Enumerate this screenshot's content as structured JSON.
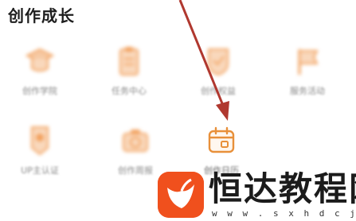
{
  "section": {
    "title": "创作成长"
  },
  "grid": {
    "items": [
      {
        "label": "创作学院",
        "icon": "graduation-cap-icon"
      },
      {
        "label": "任务中心",
        "icon": "clipboard-icon"
      },
      {
        "label": "创作权益",
        "icon": "shield-icon"
      },
      {
        "label": "服务活动",
        "icon": "flag-icon"
      },
      {
        "label": "UP主认证",
        "icon": "badge-icon"
      },
      {
        "label": "创作周报",
        "icon": "camera-icon"
      },
      {
        "label": "创作日历",
        "icon": "calendar-icon"
      }
    ]
  },
  "watermark": {
    "brand": "恒达教程网",
    "url": "w w w . s x h d c j . c o m"
  },
  "colors": {
    "accent": "#f2a15e",
    "focus_icon": "#e8903a",
    "arrow": "#b0382f",
    "watermark_logo": "#f0501d"
  }
}
